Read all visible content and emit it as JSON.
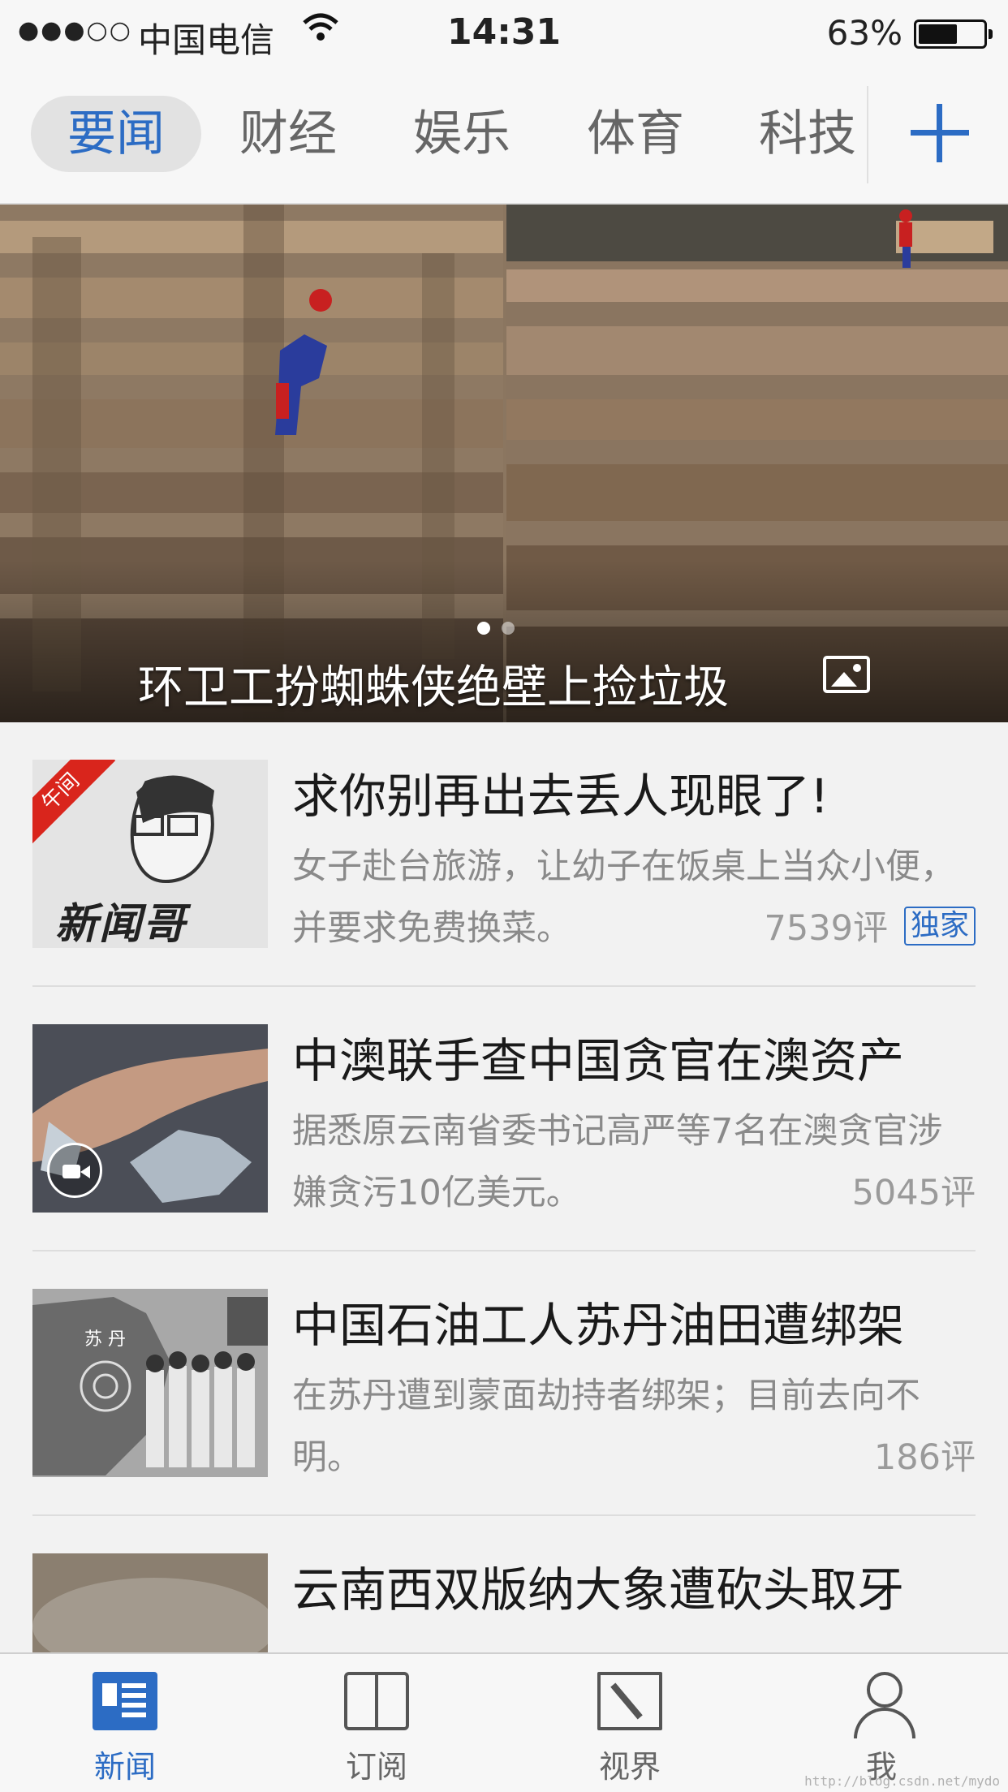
{
  "status_bar": {
    "signal": "●●●○○",
    "carrier": "中国电信",
    "time": "14:31",
    "battery": "63%",
    "battery_level": 0.63
  },
  "channels": {
    "tabs": [
      {
        "label": "要闻",
        "active": true
      },
      {
        "label": "财经",
        "active": false
      },
      {
        "label": "娱乐",
        "active": false
      },
      {
        "label": "体育",
        "active": false
      },
      {
        "label": "科技",
        "active": false
      }
    ],
    "add_icon": "plus-icon"
  },
  "hero": {
    "caption": "环卫工扮蜘蛛侠绝壁上捡垃圾",
    "slide_count": 2,
    "active_slide": 1,
    "gallery_icon": "image-gallery-icon"
  },
  "news": [
    {
      "title": "求你别再出去丢人现眼了!",
      "summary": "女子赴台旅游，让幼子在饭桌上当众小便，并要求免费换菜。",
      "comments": "7539评",
      "badge": "独家",
      "thumb_ribbon": "午间",
      "thumb_brand": "新闻哥"
    },
    {
      "title": "中澳联手查中国贪官在澳资产",
      "summary": "据悉原云南省委书记高严等7名在澳贪官涉嫌贪污10亿美元。",
      "comments": "5045评",
      "video": true
    },
    {
      "title": "中国石油工人苏丹油田遭绑架",
      "summary": "在苏丹遭到蒙面劫持者绑架；目前去向不明。",
      "comments": "186评",
      "thumb_map_label": "苏 丹"
    },
    {
      "title": "云南西双版纳大象遭砍头取牙",
      "summary": "",
      "comments": ""
    }
  ],
  "tab_bar": [
    {
      "label": "新闻",
      "icon": "news-icon",
      "active": true
    },
    {
      "label": "订阅",
      "icon": "book-icon",
      "active": false
    },
    {
      "label": "视界",
      "icon": "compass-icon",
      "active": false
    },
    {
      "label": "我",
      "icon": "person-icon",
      "active": false
    }
  ],
  "colors": {
    "accent": "#2c6cc4",
    "badge_red": "#d9251c"
  },
  "watermark": "http://blog.csdn.net/mydo"
}
